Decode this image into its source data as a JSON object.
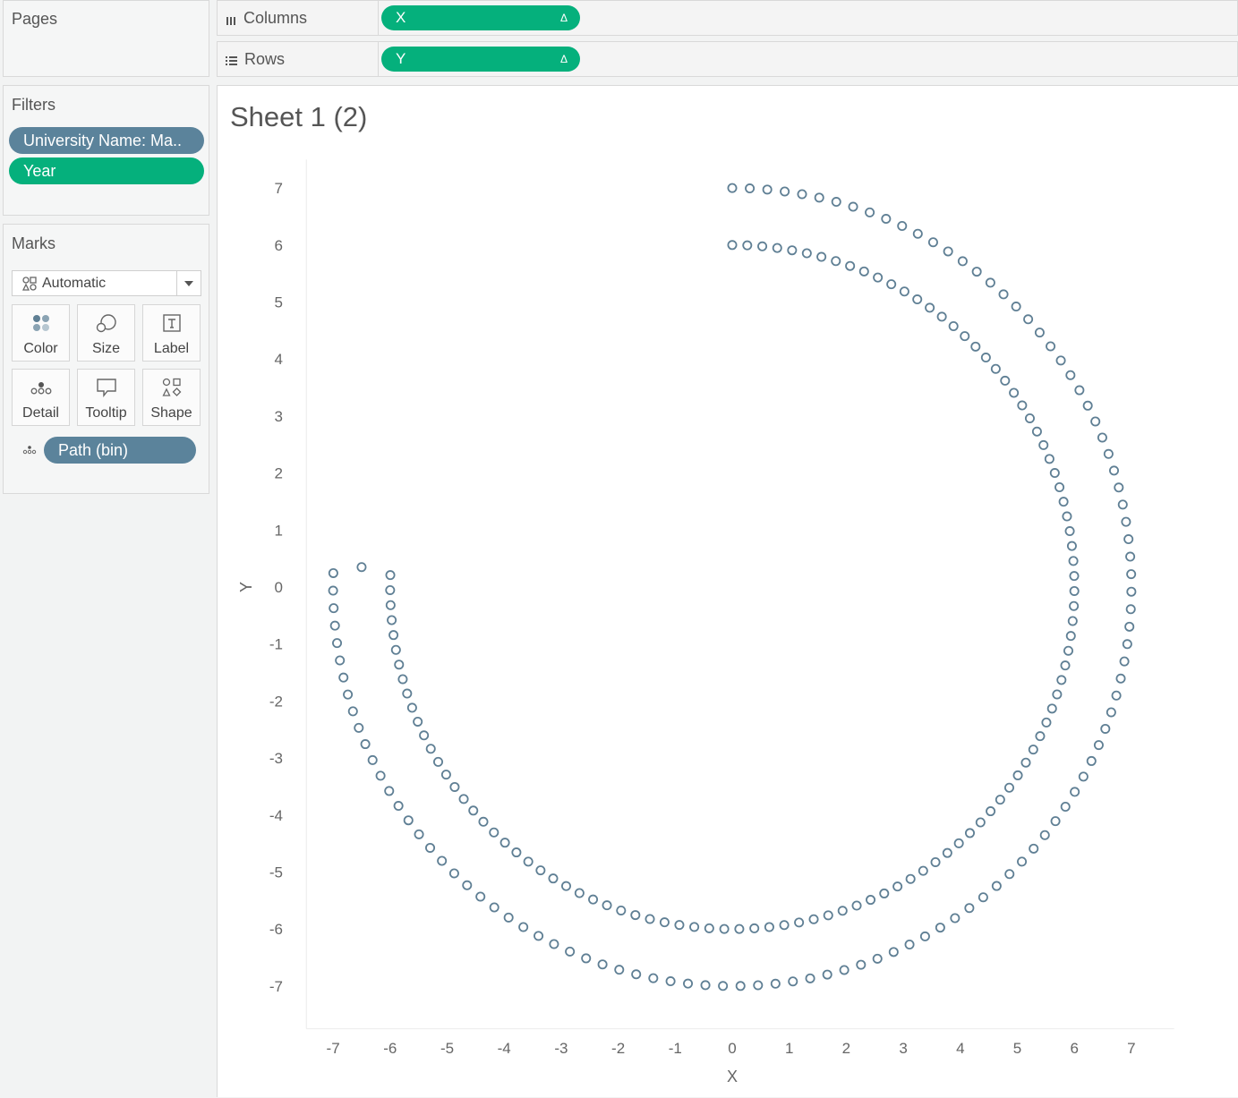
{
  "cards": {
    "pages_title": "Pages",
    "filters_title": "Filters",
    "marks_title": "Marks"
  },
  "filters": [
    {
      "label": "University Name: Ma..",
      "color": "#5b839b"
    },
    {
      "label": "Year",
      "color": "#05b07c"
    }
  ],
  "marks": {
    "type_select": "Automatic",
    "buttons": [
      {
        "label": "Color",
        "icon": "color-icon"
      },
      {
        "label": "Size",
        "icon": "size-icon"
      },
      {
        "label": "Label",
        "icon": "label-icon"
      },
      {
        "label": "Detail",
        "icon": "detail-icon"
      },
      {
        "label": "Tooltip",
        "icon": "tooltip-icon"
      },
      {
        "label": "Shape",
        "icon": "shape-icon"
      }
    ],
    "detail_pill": "Path (bin)"
  },
  "shelves": {
    "columns_label": "Columns",
    "columns_pill": "X",
    "rows_label": "Rows",
    "rows_pill": "Y",
    "delta_symbol": "Δ"
  },
  "sheet_title": "Sheet 1 (2)",
  "colors": {
    "measure_green": "#05b07c",
    "dimension_blue": "#5b839b",
    "mark_stroke": "#5f7f94"
  },
  "chart_data": {
    "type": "scatter",
    "mark": "open-circle",
    "xlabel": "X",
    "ylabel": "Y",
    "xlim": [
      -7.5,
      7.75
    ],
    "ylim": [
      -7.75,
      7.5
    ],
    "x_ticks": [
      -7,
      -6,
      -5,
      -4,
      -3,
      -2,
      -1,
      0,
      1,
      2,
      3,
      4,
      5,
      6,
      7
    ],
    "y_ticks": [
      7,
      6,
      5,
      4,
      3,
      2,
      1,
      0,
      -1,
      -2,
      -3,
      -4,
      -5,
      -6,
      -7
    ],
    "series": [
      {
        "arcs": [
          {
            "radius": 7,
            "angle_start_deg": 90,
            "angle_end_deg": -182,
            "count": 109
          },
          {
            "radius": 6,
            "angle_start_deg": 90,
            "angle_end_deg": -182,
            "count": 109
          }
        ],
        "extra_points": [
          [
            -6.5,
            0.35
          ]
        ]
      }
    ]
  }
}
